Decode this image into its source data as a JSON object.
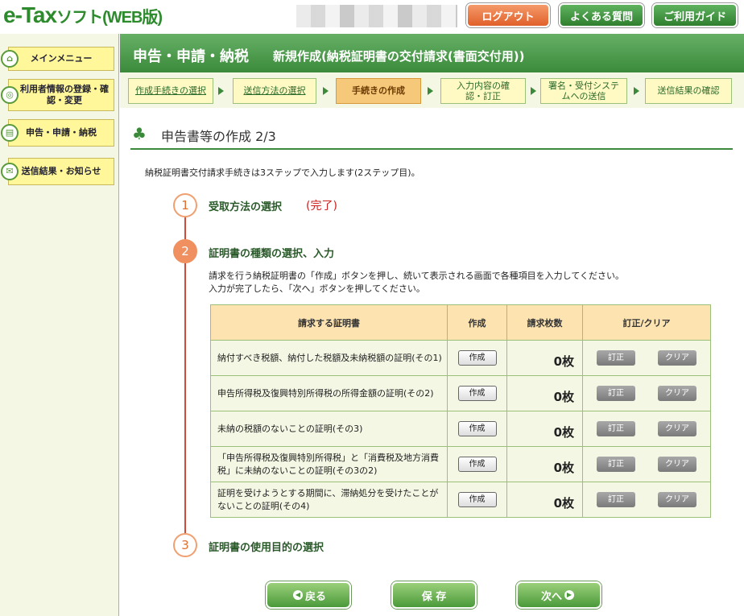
{
  "header": {
    "logo_main": "e-Tax",
    "logo_sub": "ソフト(WEB版)",
    "logout": "ログアウト",
    "faq": "よくある質問",
    "guide": "ご利用ガイド"
  },
  "sidebar": {
    "items": [
      {
        "label": "メインメニュー"
      },
      {
        "label": "利用者情報の登録・確認・変更"
      },
      {
        "label": "申告・申請・納税"
      },
      {
        "label": "送信結果・お知らせ"
      }
    ]
  },
  "titlebar": {
    "title": "申告・申請・納税",
    "subtitle": "新規作成(納税証明書の交付請求(書面交付用))"
  },
  "steps": [
    {
      "label": "作成手続きの選択"
    },
    {
      "label": "送信方法の選択"
    },
    {
      "label": "手続きの作成"
    },
    {
      "label": "入力内容の確認・訂正"
    },
    {
      "label": "署名・受付システムへの送信"
    },
    {
      "label": "送信結果の確認"
    }
  ],
  "section": {
    "title": "申告書等の作成 2/3",
    "intro": "納税証明書交付請求手続きは3ステップで入力します(2ステップ目)。"
  },
  "timeline": [
    {
      "num": "1",
      "label": "受取方法の選択",
      "status": "(完了)"
    },
    {
      "num": "2",
      "label": "証明書の種類の選択、入力"
    },
    {
      "num": "3",
      "label": "証明書の使用目的の選択"
    }
  ],
  "description": {
    "line1": "請求を行う納税証明書の「作成」ボタンを押し、続いて表示される画面で各種項目を入力してください。",
    "line2": "入力が完了したら、「次へ」ボタンを押してください。"
  },
  "table": {
    "headers": [
      "請求する証明書",
      "作成",
      "請求枚数",
      "訂正/クリア"
    ],
    "rows": [
      {
        "name": "納付すべき税額、納付した税額及未納税額の証明(その1)",
        "create": "作成",
        "count": "0枚",
        "edit": "訂正",
        "clear": "クリア"
      },
      {
        "name": "申告所得税及復興特別所得税の所得金額の証明(その2)",
        "create": "作成",
        "count": "0枚",
        "edit": "訂正",
        "clear": "クリア"
      },
      {
        "name": "未納の税額のないことの証明(その3)",
        "create": "作成",
        "count": "0枚",
        "edit": "訂正",
        "clear": "クリア"
      },
      {
        "name": "「申告所得税及復興特別所得税」と「消費税及地方消費税」に未納のないことの証明(その3の2)",
        "create": "作成",
        "count": "0枚",
        "edit": "訂正",
        "clear": "クリア"
      },
      {
        "name": "証明を受けようとする期間に、滞納処分を受けたことがないことの証明(その4)",
        "create": "作成",
        "count": "0枚",
        "edit": "訂正",
        "clear": "クリア"
      }
    ]
  },
  "buttons": {
    "back": "戻る",
    "save": "保 存",
    "next": "次へ"
  }
}
